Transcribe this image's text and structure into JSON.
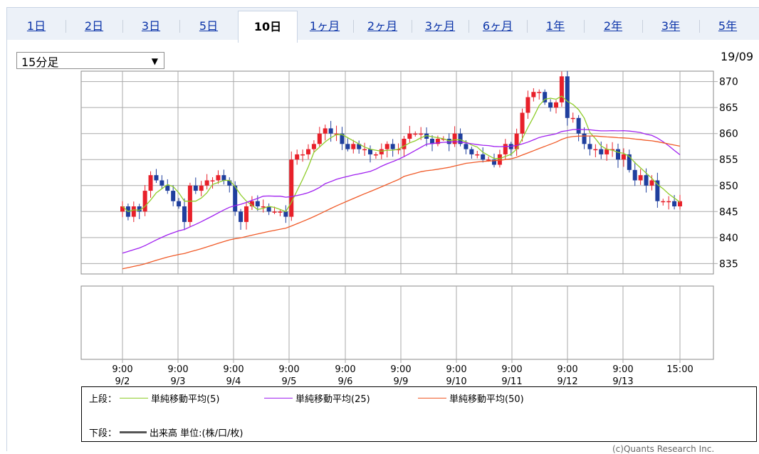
{
  "tabs": [
    {
      "label": "1日",
      "active": false
    },
    {
      "label": "2日",
      "active": false
    },
    {
      "label": "3日",
      "active": false
    },
    {
      "label": "5日",
      "active": false
    },
    {
      "label": "10日",
      "active": true
    },
    {
      "label": "1ヶ月",
      "active": false
    },
    {
      "label": "2ヶ月",
      "active": false
    },
    {
      "label": "3ヶ月",
      "active": false
    },
    {
      "label": "6ヶ月",
      "active": false
    },
    {
      "label": "1年",
      "active": false
    },
    {
      "label": "2年",
      "active": false
    },
    {
      "label": "3年",
      "active": false
    },
    {
      "label": "5年",
      "active": false
    }
  ],
  "interval_select": {
    "value": "15分足",
    "arrow": "▼"
  },
  "date_stamp": "19/09",
  "legend": {
    "upper_label": "上段：",
    "lower_label": "下段：",
    "volume_label": "出来高 単位:(株/口/枚)"
  },
  "copyright": "(c)Quants Research Inc.",
  "colors": {
    "up": "#e8202a",
    "down": "#1f3f9e",
    "ma5": "#8fcc2a",
    "ma25": "#a020f0",
    "ma50": "#f05a28",
    "grid": "#aaaaaa",
    "volume": "#555555"
  },
  "chart_data": {
    "type": "candlestick",
    "ylim": [
      833,
      872
    ],
    "yticks": [
      835,
      840,
      845,
      850,
      855,
      860,
      865,
      870
    ],
    "x_ticks": [
      {
        "time": "9:00",
        "date": "9/2"
      },
      {
        "time": "9:00",
        "date": "9/3"
      },
      {
        "time": "9:00",
        "date": "9/4"
      },
      {
        "time": "9:00",
        "date": "9/5"
      },
      {
        "time": "9:00",
        "date": "9/6"
      },
      {
        "time": "9:00",
        "date": "9/9"
      },
      {
        "time": "9:00",
        "date": "9/10"
      },
      {
        "time": "9:00",
        "date": "9/11"
      },
      {
        "time": "9:00",
        "date": "9/12"
      },
      {
        "time": "9:00",
        "date": "9/13"
      },
      {
        "time": "15:00",
        "date": ""
      }
    ],
    "close": [
      846,
      844,
      846,
      845,
      849,
      852,
      851,
      850,
      849,
      847,
      846,
      843,
      850,
      849,
      850,
      851,
      851,
      852,
      851,
      850,
      845,
      843,
      846,
      847,
      846,
      846,
      845,
      845,
      845,
      844,
      855,
      856,
      856,
      857,
      858,
      860,
      861,
      860,
      860,
      858,
      857,
      858,
      857,
      857,
      856,
      856,
      857,
      858,
      857,
      857,
      859,
      860,
      860,
      860,
      859,
      858,
      859,
      859,
      858,
      860,
      858,
      857,
      856,
      856,
      855,
      855,
      854,
      856,
      858,
      857,
      860,
      864,
      867,
      868,
      868,
      866,
      865,
      866,
      871,
      863,
      863,
      860,
      858,
      857,
      857,
      856,
      857,
      857,
      855,
      856,
      853,
      851,
      852,
      850,
      851,
      847,
      847,
      847,
      846,
      847
    ],
    "series": [
      {
        "name": "単純移動平均(5)",
        "period": 5,
        "color": "#8fcc2a"
      },
      {
        "name": "単純移動平均(25)",
        "period": 25,
        "color": "#a020f0"
      },
      {
        "name": "単純移動平均(50)",
        "period": 50,
        "color": "#f05a28"
      }
    ],
    "ma25_start": 837,
    "ma50_start": 834
  }
}
